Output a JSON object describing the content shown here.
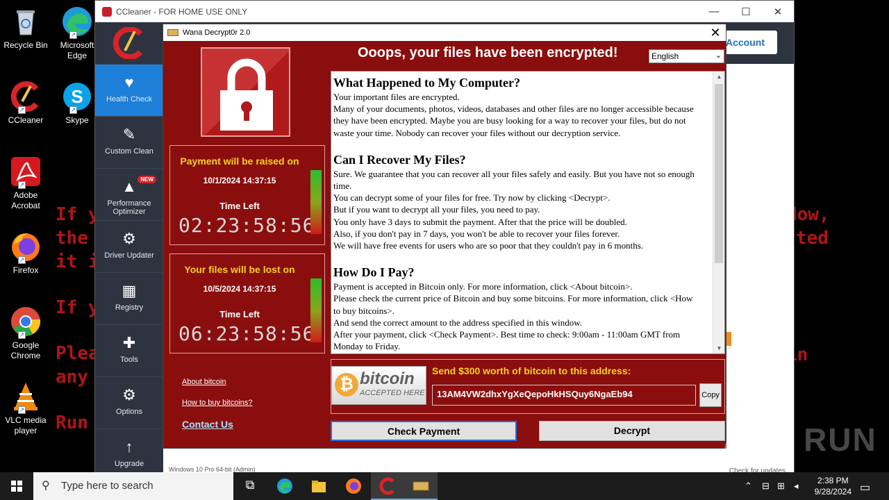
{
  "desktop": {
    "icons": [
      {
        "label": "Recycle Bin",
        "name": "recycle-bin-icon"
      },
      {
        "label": "Microsoft Edge",
        "name": "edge-icon"
      },
      {
        "label": "CCleaner",
        "name": "ccleaner-icon"
      },
      {
        "label": "Skype",
        "name": "skype-icon"
      },
      {
        "label": "Adobe Acrobat",
        "name": "acrobat-icon"
      },
      {
        "label": "Firefox",
        "name": "firefox-icon"
      },
      {
        "label": "Google Chrome",
        "name": "chrome-icon"
      },
      {
        "label": "VLC media player",
        "name": "vlc-icon"
      }
    ],
    "bg_text": {
      "l1": "If y",
      "l2": "the",
      "l3": "it i",
      "l4": "If y",
      "l5": "Plea",
      "l6": "any",
      "l7": "Run",
      "r1": "dow,",
      "r2": "ted",
      "r3": "in"
    }
  },
  "ccleaner": {
    "title": "CCleaner - FOR HOME USE ONLY",
    "account": "Account",
    "nav": [
      {
        "label": "Health Check",
        "icon": "heart-icon"
      },
      {
        "label": "Custom Clean",
        "icon": "brush-icon"
      },
      {
        "label": "Performance Optimizer",
        "icon": "rocket-icon",
        "badge": "NEW"
      },
      {
        "label": "Driver Updater",
        "icon": "gear-chip-icon"
      },
      {
        "label": "Registry",
        "icon": "grid-icon"
      },
      {
        "label": "Tools",
        "icon": "wrench-icon"
      },
      {
        "label": "Options",
        "icon": "gear-icon"
      },
      {
        "label": "Upgrade",
        "icon": "arrow-up-icon"
      }
    ],
    "status": "Windows 10 Pro 64-bit (Admin)",
    "check_updates": "Check for updates"
  },
  "wannacry": {
    "title": "Wana Decrypt0r 2.0",
    "heading": "Ooops, your files have been encrypted!",
    "language": "English",
    "raise": {
      "label": "Payment will be raised on",
      "date": "10/1/2024 14:37:15",
      "time_left_label": "Time Left",
      "countdown": "02:23:58:56"
    },
    "lost": {
      "label": "Your files will be lost on",
      "date": "10/5/2024 14:37:15",
      "time_left_label": "Time Left",
      "countdown": "06:23:58:56"
    },
    "about_bitcoin": "About bitcoin",
    "how_to_buy": "How to buy bitcoins?",
    "contact": "Contact Us",
    "sections": {
      "h1": "What Happened to My Computer?",
      "p1a": "Your important files are encrypted.",
      "p1b": "Many of your documents, photos, videos, databases and other files are no longer accessible because they have been encrypted. Maybe you are busy looking for a way to recover your files, but do not waste your time. Nobody can recover your files without our decryption service.",
      "h2": "Can I Recover My Files?",
      "p2a": "Sure. We guarantee that you can recover all your files safely and easily. But you have not so enough time.",
      "p2b": "You can decrypt some of your files for free. Try now by clicking <Decrypt>.",
      "p2c": "But if you want to decrypt all your files, you need to pay.",
      "p2d": "You only have 3 days to submit the payment. After that the price will be doubled.",
      "p2e": "Also, if you don't pay in 7 days, you won't be able to recover your files forever.",
      "p2f": "We will have free events for users who are so poor that they couldn't pay in 6 months.",
      "h3": "How Do I Pay?",
      "p3a": "Payment is accepted in Bitcoin only. For more information, click <About bitcoin>.",
      "p3b": "Please check the current price of Bitcoin and buy some bitcoins. For more information, click <How to buy bitcoins>.",
      "p3c": "And send the correct amount to the address specified in this window.",
      "p3d": "After your payment, click <Check Payment>. Best time to check: 9:00am - 11:00am GMT from Monday to Friday."
    },
    "send_label": "Send $300 worth of bitcoin to this address:",
    "bitcoin_word": "bitcoin",
    "bitcoin_accepted": "ACCEPTED HERE",
    "address": "13AM4VW2dhxYgXeQepoHkHSQuy6NgaEb94",
    "copy": "Copy",
    "check_payment": "Check Payment",
    "decrypt": "Decrypt"
  },
  "taskbar": {
    "search_placeholder": "Type here to search",
    "time": "2:38 PM",
    "date": "9/28/2024",
    "watermark": "ANY RUN"
  }
}
